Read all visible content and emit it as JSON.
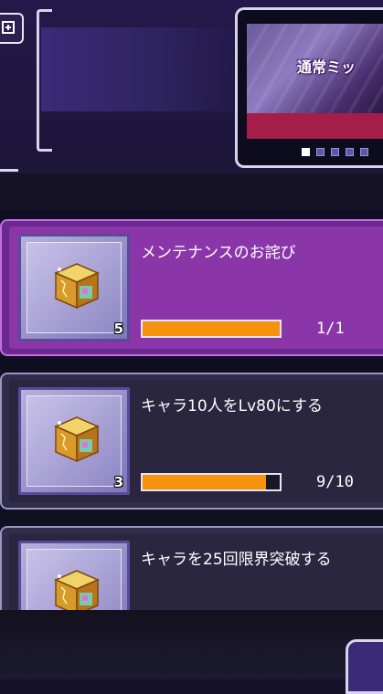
{
  "banner": {
    "text": "通常ミッ",
    "page_count": 5,
    "active_page": 0
  },
  "missions": [
    {
      "title": "メンテナンスのお詫び",
      "reward_icon": "treasure-chest-icon",
      "reward_count": "5",
      "progress_text": "1/1",
      "progress_fraction": 1.0,
      "highlighted": true
    },
    {
      "title": "キャラ10人をLv80にする",
      "reward_icon": "treasure-chest-icon",
      "reward_count": "3",
      "progress_text": "9/10",
      "progress_fraction": 0.9,
      "highlighted": false
    },
    {
      "title": "キャラを25回限界突破する",
      "reward_icon": "treasure-chest-icon",
      "reward_count": "",
      "progress_text": "",
      "progress_fraction": 0,
      "highlighted": false
    }
  ],
  "colors": {
    "bar_fill": "#f5930e",
    "highlight_card": "#8a36a8",
    "banner_red": "#a51e4a"
  }
}
